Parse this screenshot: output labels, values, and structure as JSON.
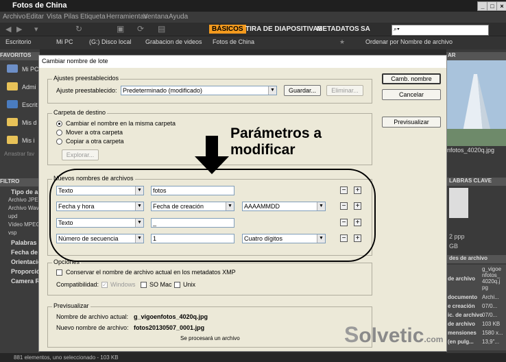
{
  "app": {
    "title": "Fotos de China",
    "menu": [
      "Archivo",
      "Editar",
      "Vista",
      "Pilas",
      "Etiqueta",
      "Herramientas",
      "Ventana",
      "Ayuda"
    ],
    "workspaces": [
      "BÁSICOS",
      "TIRA DE DIAPOSITIVAS",
      "METADATOS",
      "SA"
    ],
    "search_placeholder": "",
    "path": [
      "Escritorio",
      "Mi PC",
      "(G:) Disco local",
      "Grabacion de videos",
      "Fotos de China"
    ],
    "sort": "Ordenar por Nombre de archivo",
    "accent": "#f39a1e"
  },
  "left_panel": {
    "favorites_header": "FAVORITOS",
    "items": [
      "Mi PC",
      "Admi",
      "Escrit",
      "Mis d",
      "Mis i"
    ],
    "drag_hint": "Arrastrar fav",
    "filter_header": "FILTRO",
    "filter_items": [
      "Tipo de a",
      "Archivo JPEG",
      "Archivo Wav",
      "upd",
      "Vídeo MPEG",
      "vsp"
    ],
    "sections": [
      "Palabras",
      "Fecha de",
      "Orientació",
      "Proporción",
      "Camera R"
    ]
  },
  "right_panel": {
    "header": "AR",
    "filename": "nfotos_4020q.jpg",
    "keywords_header": "LABRAS CLAVE",
    "ppp": "2 ppp",
    "gb": "GB",
    "meta_header": "des de archivo",
    "meta_rows": [
      {
        "k": "",
        "v": "g_vigoe nfotos_ 4020q.j pg"
      },
      {
        "k": "de archivo",
        "v": ""
      },
      {
        "k": "documento",
        "v": "Archi..."
      },
      {
        "k": "e creación",
        "v": "07/0..."
      },
      {
        "k": "ic. de archivo",
        "v": "07/0..."
      },
      {
        "k": "de archivo",
        "v": "103 KB"
      },
      {
        "k": "mensiones",
        "v": "1580 x..."
      },
      {
        "k": "(en pulg...",
        "v": "13,9\"..."
      }
    ]
  },
  "status": "881 elementos, uno seleccionado - 103 KB",
  "dialog": {
    "title": "Cambiar nombre de lote",
    "buttons": {
      "rename": "Camb. nombre",
      "cancel": "Cancelar",
      "preview": "Previsualizar"
    },
    "presets": {
      "group_label": "Ajustes preestablecidos",
      "label": "Ajuste preestablecido:",
      "value": "Predeterminado (modificado)",
      "save": "Guardar...",
      "delete": "Eliminar..."
    },
    "destination": {
      "group_label": "Carpeta de destino",
      "options": [
        "Cambiar el nombre en la misma carpeta",
        "Mover a otra carpeta",
        "Copiar a otra carpeta"
      ],
      "browse": "Explorar..."
    },
    "new_names": {
      "group_label": "Nuevos nombres de archivos",
      "rows": [
        {
          "type": "Texto",
          "value": "fotos",
          "extra": ""
        },
        {
          "type": "Fecha y hora",
          "value": "Fecha de creación",
          "extra": "AAAAMMDD"
        },
        {
          "type": "Texto",
          "value": "_",
          "extra": ""
        },
        {
          "type": "Número de secuencia",
          "value": "1",
          "extra": "Cuatro dígitos"
        }
      ]
    },
    "options": {
      "group_label": "Opciones",
      "keep_name": "Conservar el nombre de archivo actual en los metadatos XMP",
      "compat_label": "Compatibilidad:",
      "compat": [
        "Windows",
        "SO Mac",
        "Unix"
      ]
    },
    "preview": {
      "group_label": "Previsualizar",
      "current_label": "Nombre de archivo actual:",
      "current_value": "g_vigoenfotos_4020q.jpg",
      "new_label": "Nuevo nombre de archivo:",
      "new_value": "fotos20130507_0001.jpg",
      "note": "Se procesará un archivo"
    }
  },
  "annotation": {
    "line1": "Parámetros a",
    "line2": "modificar"
  },
  "watermark": {
    "brand": "olvetic",
    "suffix": ".com"
  }
}
